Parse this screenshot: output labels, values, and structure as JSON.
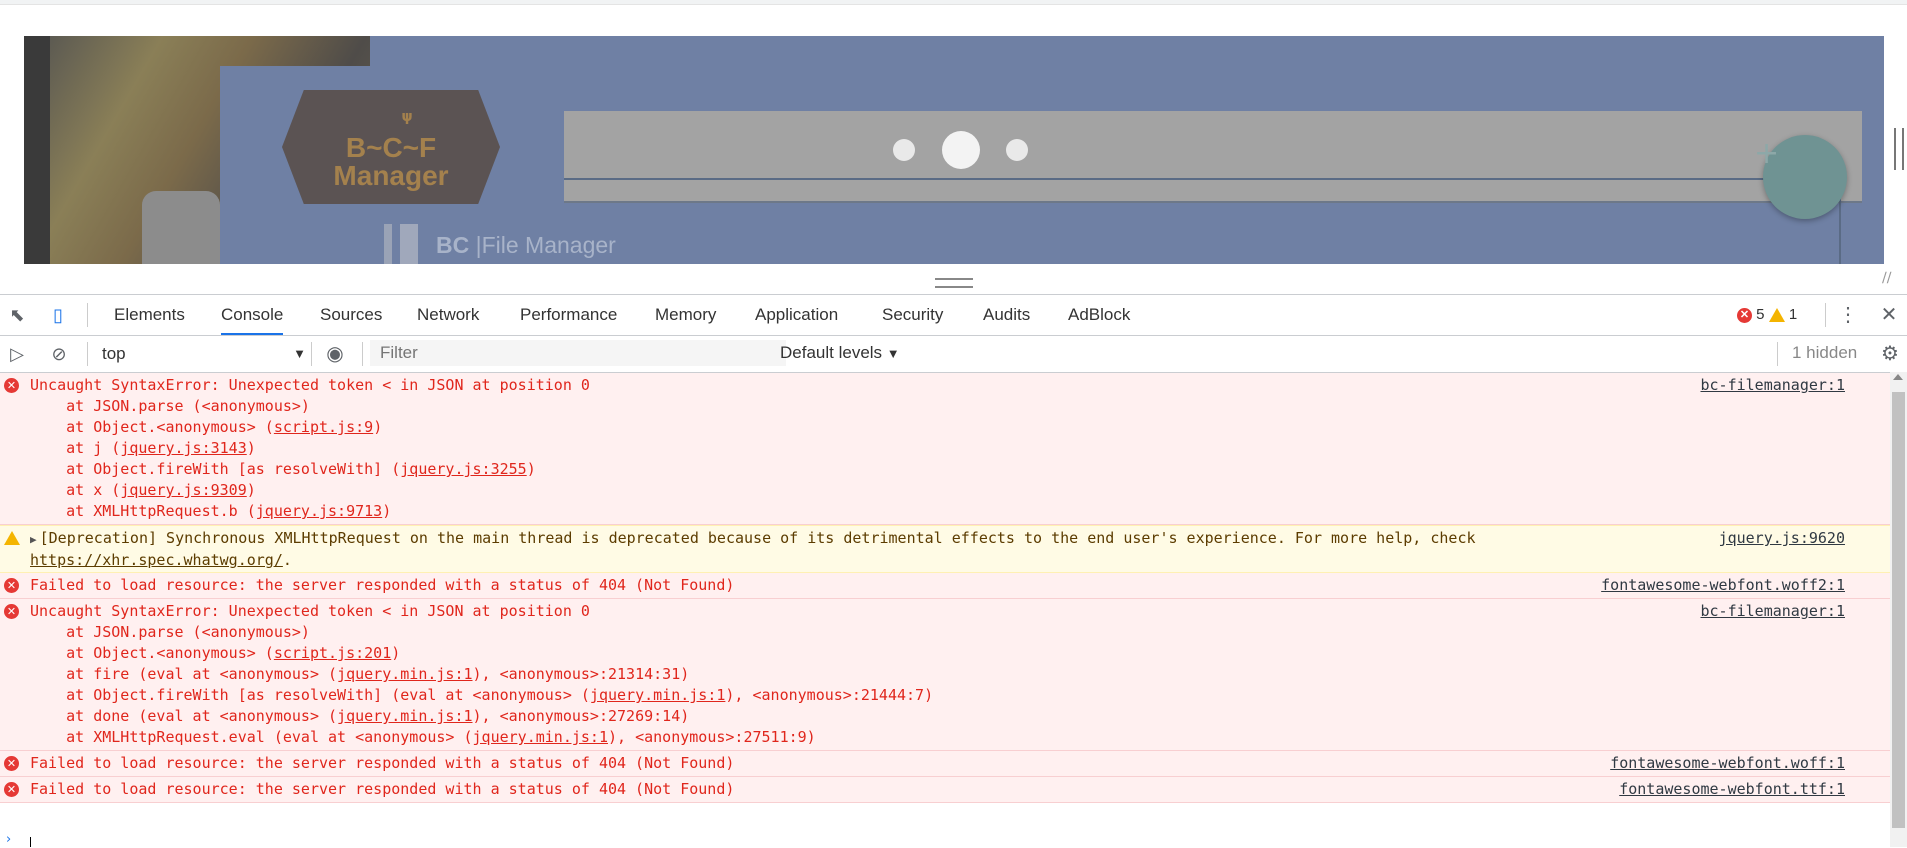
{
  "preview": {
    "logo_text": "B~C~F\nManager",
    "brand_bold": "BC",
    "brand_rest": " |File Manager"
  },
  "tabs": [
    "Elements",
    "Console",
    "Sources",
    "Network",
    "Performance",
    "Memory",
    "Application",
    "Security",
    "Audits",
    "AdBlock"
  ],
  "counts": {
    "errors": "5",
    "warnings": "1"
  },
  "filterbar": {
    "context": "top",
    "filter_placeholder": "Filter",
    "levels": "Default levels",
    "hidden": "1 hidden"
  },
  "messages": [
    {
      "level": "error",
      "source": "bc-filemanager:1",
      "head": "Uncaught SyntaxError: Unexpected token < in JSON at position 0",
      "stack": [
        [
          "    at JSON.parse (<anonymous>)",
          "",
          ""
        ],
        [
          "    at Object.<anonymous> (",
          "script.js:9",
          ")"
        ],
        [
          "    at j (",
          "jquery.js:3143",
          ")"
        ],
        [
          "    at Object.fireWith [as resolveWith] (",
          "jquery.js:3255",
          ")"
        ],
        [
          "    at x (",
          "jquery.js:9309",
          ")"
        ],
        [
          "    at XMLHttpRequest.b (",
          "jquery.js:9713",
          ")"
        ]
      ]
    },
    {
      "level": "warning",
      "source": "jquery.js:9620",
      "head": "[Deprecation] Synchronous XMLHttpRequest on the main thread is deprecated because of its detrimental effects to the end user's experience. For more help, check ",
      "link": "https://xhr.spec.whatwg.org/",
      "tail": "."
    },
    {
      "level": "error",
      "source": "fontawesome-webfont.woff2:1",
      "head": "Failed to load resource: the server responded with a status of 404 (Not Found)",
      "stack": []
    },
    {
      "level": "error",
      "source": "bc-filemanager:1",
      "head": "Uncaught SyntaxError: Unexpected token < in JSON at position 0",
      "stack": [
        [
          "    at JSON.parse (<anonymous>)",
          "",
          ""
        ],
        [
          "    at Object.<anonymous> (",
          "script.js:201",
          ")"
        ],
        [
          "    at fire (eval at <anonymous> (",
          "jquery.min.js:1",
          "), <anonymous>:21314:31)"
        ],
        [
          "    at Object.fireWith [as resolveWith] (eval at <anonymous> (",
          "jquery.min.js:1",
          "), <anonymous>:21444:7)"
        ],
        [
          "    at done (eval at <anonymous> (",
          "jquery.min.js:1",
          "), <anonymous>:27269:14)"
        ],
        [
          "    at XMLHttpRequest.eval (eval at <anonymous> (",
          "jquery.min.js:1",
          "), <anonymous>:27511:9)"
        ]
      ]
    },
    {
      "level": "error",
      "source": "fontawesome-webfont.woff:1",
      "head": "Failed to load resource: the server responded with a status of 404 (Not Found)",
      "stack": []
    },
    {
      "level": "error",
      "source": "fontawesome-webfont.ttf:1",
      "head": "Failed to load resource: the server responded with a status of 404 (Not Found)",
      "stack": []
    }
  ]
}
